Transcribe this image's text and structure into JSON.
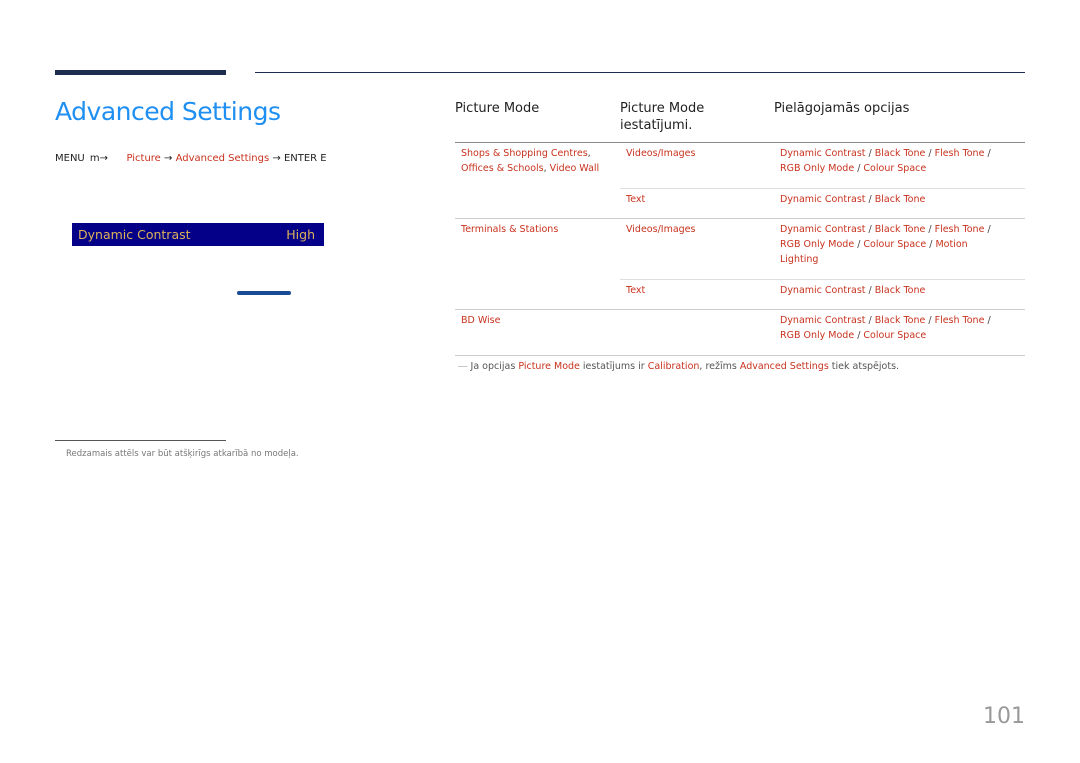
{
  "page": {
    "title": "Advanced Settings",
    "page_number": "101",
    "menu_path": {
      "menu": "MENU",
      "menu_icon": "m-arrow-icon",
      "items": [
        "Picture",
        "Advanced Settings"
      ],
      "arrow": "→",
      "enter": "ENTER E"
    }
  },
  "osd": {
    "label": "Dynamic Contrast",
    "value": "High",
    "colors": {
      "background": "#040088",
      "text": "#dcb35a"
    }
  },
  "footnote": "Redzamais attēls var būt atšķirīgs atkarībā no modeļa.",
  "table": {
    "headers": [
      "Picture Mode",
      "Picture Mode iestatījumi.",
      "Pielāgojamās opcijas"
    ],
    "groups": [
      {
        "mode": [
          "Shops & Shopping Centres",
          "Offices & Schools",
          "Video Wall"
        ],
        "rows": [
          {
            "setting": "Videos/Images",
            "options": [
              "Dynamic Contrast",
              "Black Tone",
              "Flesh Tone",
              "RGB Only Mode",
              "Colour Space"
            ]
          },
          {
            "setting": "Text",
            "options": [
              "Dynamic Contrast",
              "Black Tone"
            ]
          }
        ]
      },
      {
        "mode": [
          "Terminals & Stations"
        ],
        "rows": [
          {
            "setting": "Videos/Images",
            "options": [
              "Dynamic Contrast",
              "Black Tone",
              "Flesh Tone",
              "RGB Only Mode",
              "Colour Space",
              "Motion Lighting"
            ]
          },
          {
            "setting": "Text",
            "options": [
              "Dynamic Contrast",
              "Black Tone"
            ]
          }
        ]
      },
      {
        "mode": [
          "BD Wise"
        ],
        "rows": [
          {
            "setting": "",
            "options": [
              "Dynamic Contrast",
              "Black Tone",
              "Flesh Tone",
              "RGB Only Mode",
              "Colour Space"
            ]
          }
        ]
      }
    ]
  },
  "note": {
    "dash": "―",
    "parts": [
      {
        "text": " Ja opcijas ",
        "hl": false
      },
      {
        "text": "Picture Mode",
        "hl": true
      },
      {
        "text": " iestatījums ir ",
        "hl": false
      },
      {
        "text": "Calibration",
        "hl": true
      },
      {
        "text": ", režīms ",
        "hl": false
      },
      {
        "text": "Advanced Settings",
        "hl": true
      },
      {
        "text": " tiek atspējots.",
        "hl": false
      }
    ]
  },
  "colors": {
    "title": "#1f8ff2",
    "highlight": "#c8321e",
    "rule": "#1e2c4d"
  }
}
